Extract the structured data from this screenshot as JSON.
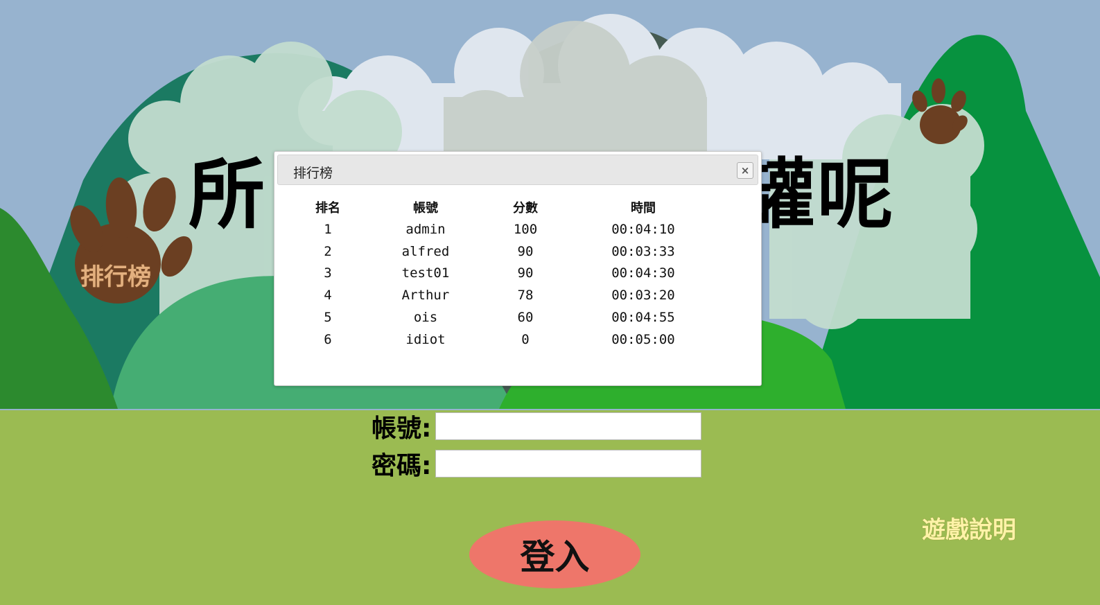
{
  "title_left": "所",
  "title_right": "罐呢",
  "ranking_link": "排行榜",
  "help_link": "遊戲說明",
  "login": {
    "account_label": "帳號:",
    "password_label": "密碼:",
    "account_value": "",
    "password_value": "",
    "submit_label": "登入"
  },
  "dialog": {
    "title": "排行榜",
    "close_icon": "×",
    "columns": [
      "排名",
      "帳號",
      "分數",
      "時間"
    ],
    "rows": [
      [
        "1",
        "admin",
        "100",
        "00:04:10"
      ],
      [
        "2",
        "alfred",
        "90",
        "00:03:33"
      ],
      [
        "3",
        "test01",
        "90",
        "00:04:30"
      ],
      [
        "4",
        "Arthur",
        "78",
        "00:03:20"
      ],
      [
        "5",
        "ois",
        "60",
        "00:04:55"
      ],
      [
        "6",
        "idiot",
        "0",
        "00:05:00"
      ]
    ]
  },
  "colors": {
    "sky": "#97b3cf",
    "grass": "#9bbb52",
    "paw": "#6b3f22",
    "login_button": "#ee766a",
    "help_text": "#fff3a8"
  }
}
